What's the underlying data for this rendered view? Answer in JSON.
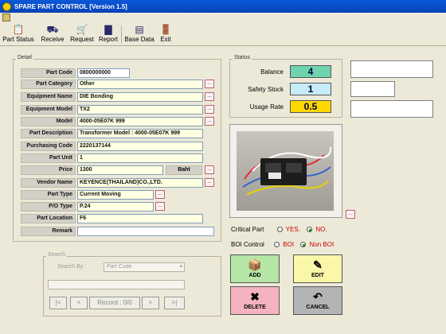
{
  "window": {
    "title": "SPARE PART CONTROL [Version 1.5]"
  },
  "toolbar": [
    {
      "label": "Part Status",
      "icon": "clipboard-icon"
    },
    {
      "label": "Receive",
      "icon": "truck-icon"
    },
    {
      "label": "Request",
      "icon": "cart-icon"
    },
    {
      "label": "Report",
      "icon": "bar-chart-icon"
    },
    {
      "label": "Base Data",
      "icon": "database-icon"
    },
    {
      "label": "Exit",
      "icon": "exit-door-icon"
    }
  ],
  "detail": {
    "frame_label": "Detail",
    "fields": [
      {
        "label": "Part Code",
        "value": "0800000000"
      },
      {
        "label": "Part Category",
        "value": "Other"
      },
      {
        "label": "Equipment Name",
        "value": "DIE Bonding"
      },
      {
        "label": "Equipment Model",
        "value": "TX2"
      },
      {
        "label": "Model",
        "value": "4000-05E07K 999"
      },
      {
        "label": "Part Description",
        "value": "Transformer Model : 4000-05E07K 999"
      },
      {
        "label": "Purchasing Code",
        "value": "2220137144"
      },
      {
        "label": "Part Unit",
        "value": "1"
      },
      {
        "label": "Price",
        "value": "1300"
      },
      {
        "label": "Vendor Name",
        "value": "KEYENCE(THAILAND)CO.,LTD."
      },
      {
        "label": "Part Type",
        "value": "Current Moving"
      },
      {
        "label": "P/O Type",
        "value": "P.24"
      },
      {
        "label": "Part Location",
        "value": "F6"
      },
      {
        "label": "Remark",
        "value": ""
      }
    ],
    "currency": "Baht",
    "lookup_glyph": "..."
  },
  "status": {
    "frame_label": "Status",
    "balance_label": "Balance",
    "balance": "4",
    "safety_label": "Safety Stock",
    "safety": "1",
    "usage_label": "Usage Rate",
    "usage": "0.5",
    "colors": {
      "balance": "#6fd3b0",
      "safety": "#c6ecf7",
      "usage": "#ffd700"
    }
  },
  "flags": {
    "critical_label": "Critical Part",
    "critical_yes": "YES.",
    "critical_no": "NO.",
    "critical_selected": "NO.",
    "boi_label": "BOI Control",
    "boi_yes": "BOI",
    "boi_no": "Non BOI",
    "boi_selected": "Non BOI"
  },
  "actions": [
    {
      "label": "ADD",
      "icon": "add-box-icon",
      "color": "#b5e6a5"
    },
    {
      "label": "EDIT",
      "icon": "edit-pencil-icon",
      "color": "#fbf7a8"
    },
    {
      "label": "DELETE",
      "icon": "delete-icon",
      "color": "#f4b3bf"
    },
    {
      "label": "CANCEL",
      "icon": "cancel-icon",
      "color": "#b4b4b4"
    }
  ],
  "search": {
    "frame_label": "Search",
    "search_by_label": "Search By :",
    "search_by_value": "Part Code",
    "record_label": "Record : 0/0",
    "nav": {
      "first": "|<",
      "prev": "<",
      "next": ">",
      "last": ">|"
    }
  }
}
